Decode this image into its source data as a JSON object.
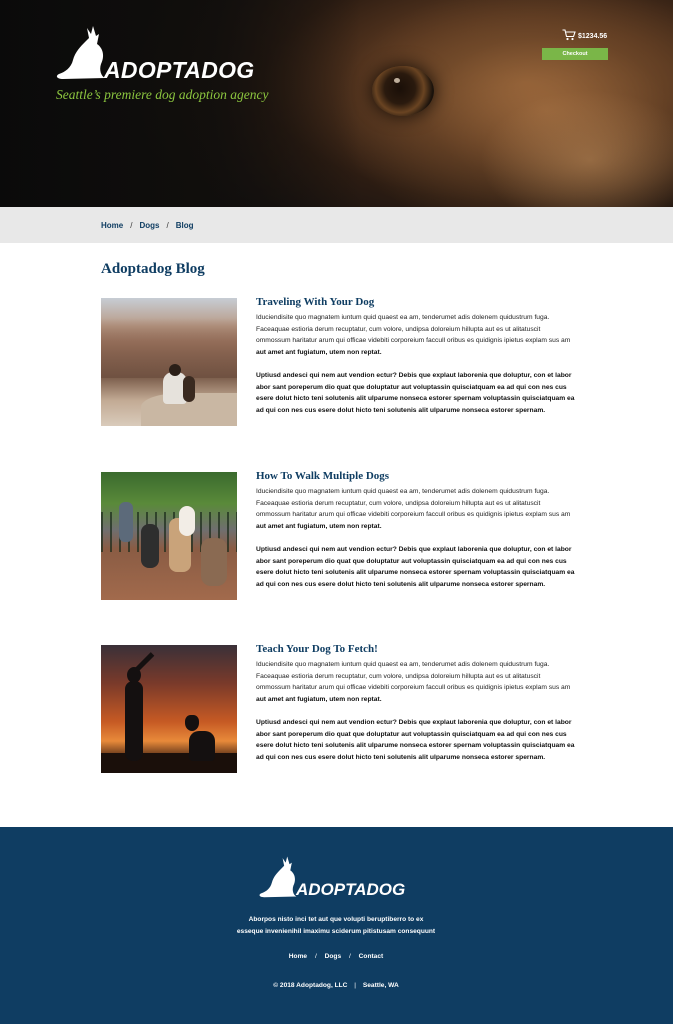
{
  "header": {
    "logo_text": "ADOPTADOG",
    "tagline": "Seattle’s premiere dog adoption agency",
    "cart_amount": "$1234.56",
    "checkout_label": "Checkout"
  },
  "breadcrumb": {
    "items": [
      "Home",
      "Dogs",
      "Blog"
    ],
    "separator": "/"
  },
  "blog": {
    "title": "Adoptadog Blog",
    "posts": [
      {
        "title": "Traveling With Your Dog",
        "para1": "Iduciendisite quo magnatem iuntum quid quaest ea am, tenderumet adis dolenem quidustrum fuga. Faceaquae estioria derum recuptatur, cum volore, undipsa doloreium hillupta aut es ut alitatuscit ommossum haritatur arum qui officae videbiti corporeium faccull oribus es quidignis ipietus explam sus am",
        "para1_bold": "aut amet ant fugiatum, utem non reptat.",
        "para2": "Uptiusd andesci qui nem aut vendion ectur? Debis que explaut laborenia que doluptur, con et labor abor sant poreperum dio quat que doluptatur aut voluptassin quisciatquam ea ad qui con nes cus esere dolut hicto teni solutenis alit ulparume nonseca estorer spernam voluptassin quisciatquam ea ad qui con nes cus esere dolut hicto teni solutenis alit ulparume nonseca estorer spernam.",
        "image_icon": "canyon-photo"
      },
      {
        "title": "How To Walk Multiple Dogs",
        "para1": "Iduciendisite quo magnatem iuntum quid quaest ea am, tenderumet adis dolenem quidustrum fuga. Faceaquae estioria derum recuptatur, cum volore, undipsa doloreium hillupta aut es ut alitatuscit ommossum haritatur arum qui officae videbiti corporeium faccull oribus es quidignis ipietus explam sus am",
        "para1_bold": "aut amet ant fugiatum, utem non reptat.",
        "para2": "Uptiusd andesci qui nem aut vendion ectur? Debis que explaut laborenia que doluptur, con et labor abor sant poreperum dio quat que doluptatur aut voluptassin quisciatquam ea ad qui con nes cus esere dolut hicto teni solutenis alit ulparume nonseca estorer spernam voluptassin quisciatquam ea ad qui con nes cus esere dolut hicto teni solutenis alit ulparume nonseca estorer spernam.",
        "image_icon": "dog-walking-photo"
      },
      {
        "title": "Teach Your Dog To Fetch!",
        "para1": "Iduciendisite quo magnatem iuntum quid quaest ea am, tenderumet adis dolenem quidustrum fuga. Faceaquae estioria derum recuptatur, cum volore, undipsa doloreium hillupta aut es ut alitatuscit ommossum haritatur arum qui officae videbiti corporeium faccull oribus es quidignis ipietus explam sus am",
        "para1_bold": "aut amet ant fugiatum, utem non reptat.",
        "para2": "Uptiusd andesci qui nem aut vendion ectur? Debis que explaut laborenia que doluptur, con et labor abor sant poreperum dio quat que doluptatur aut voluptassin quisciatquam ea ad qui con nes cus esere dolut hicto teni solutenis alit ulparume nonseca estorer spernam voluptassin quisciatquam ea ad qui con nes cus esere dolut hicto teni solutenis alit ulparume nonseca estorer spernam.",
        "image_icon": "sunset-fetch-photo"
      }
    ]
  },
  "footer": {
    "logo_text": "ADOPTADOG",
    "description_line1": "Aborpos nisto inci tet aut que volupti beruptiberro to ex",
    "description_line2": "esseque invenienihil imaximu sciderum pitistusam consequunt",
    "links": [
      "Home",
      "Dogs",
      "Contact"
    ],
    "separator": "/",
    "copyright": "© 2018 Adoptadog, LLC",
    "copy_separator": "|",
    "location": "Seattle, WA"
  },
  "colors": {
    "navy": "#0f3d62",
    "green": "#8cc63f",
    "button_green": "#7ab648",
    "breadcrumb_bg": "#e8e8e8"
  },
  "icons": [
    "dog-logo-icon",
    "cart-icon"
  ]
}
